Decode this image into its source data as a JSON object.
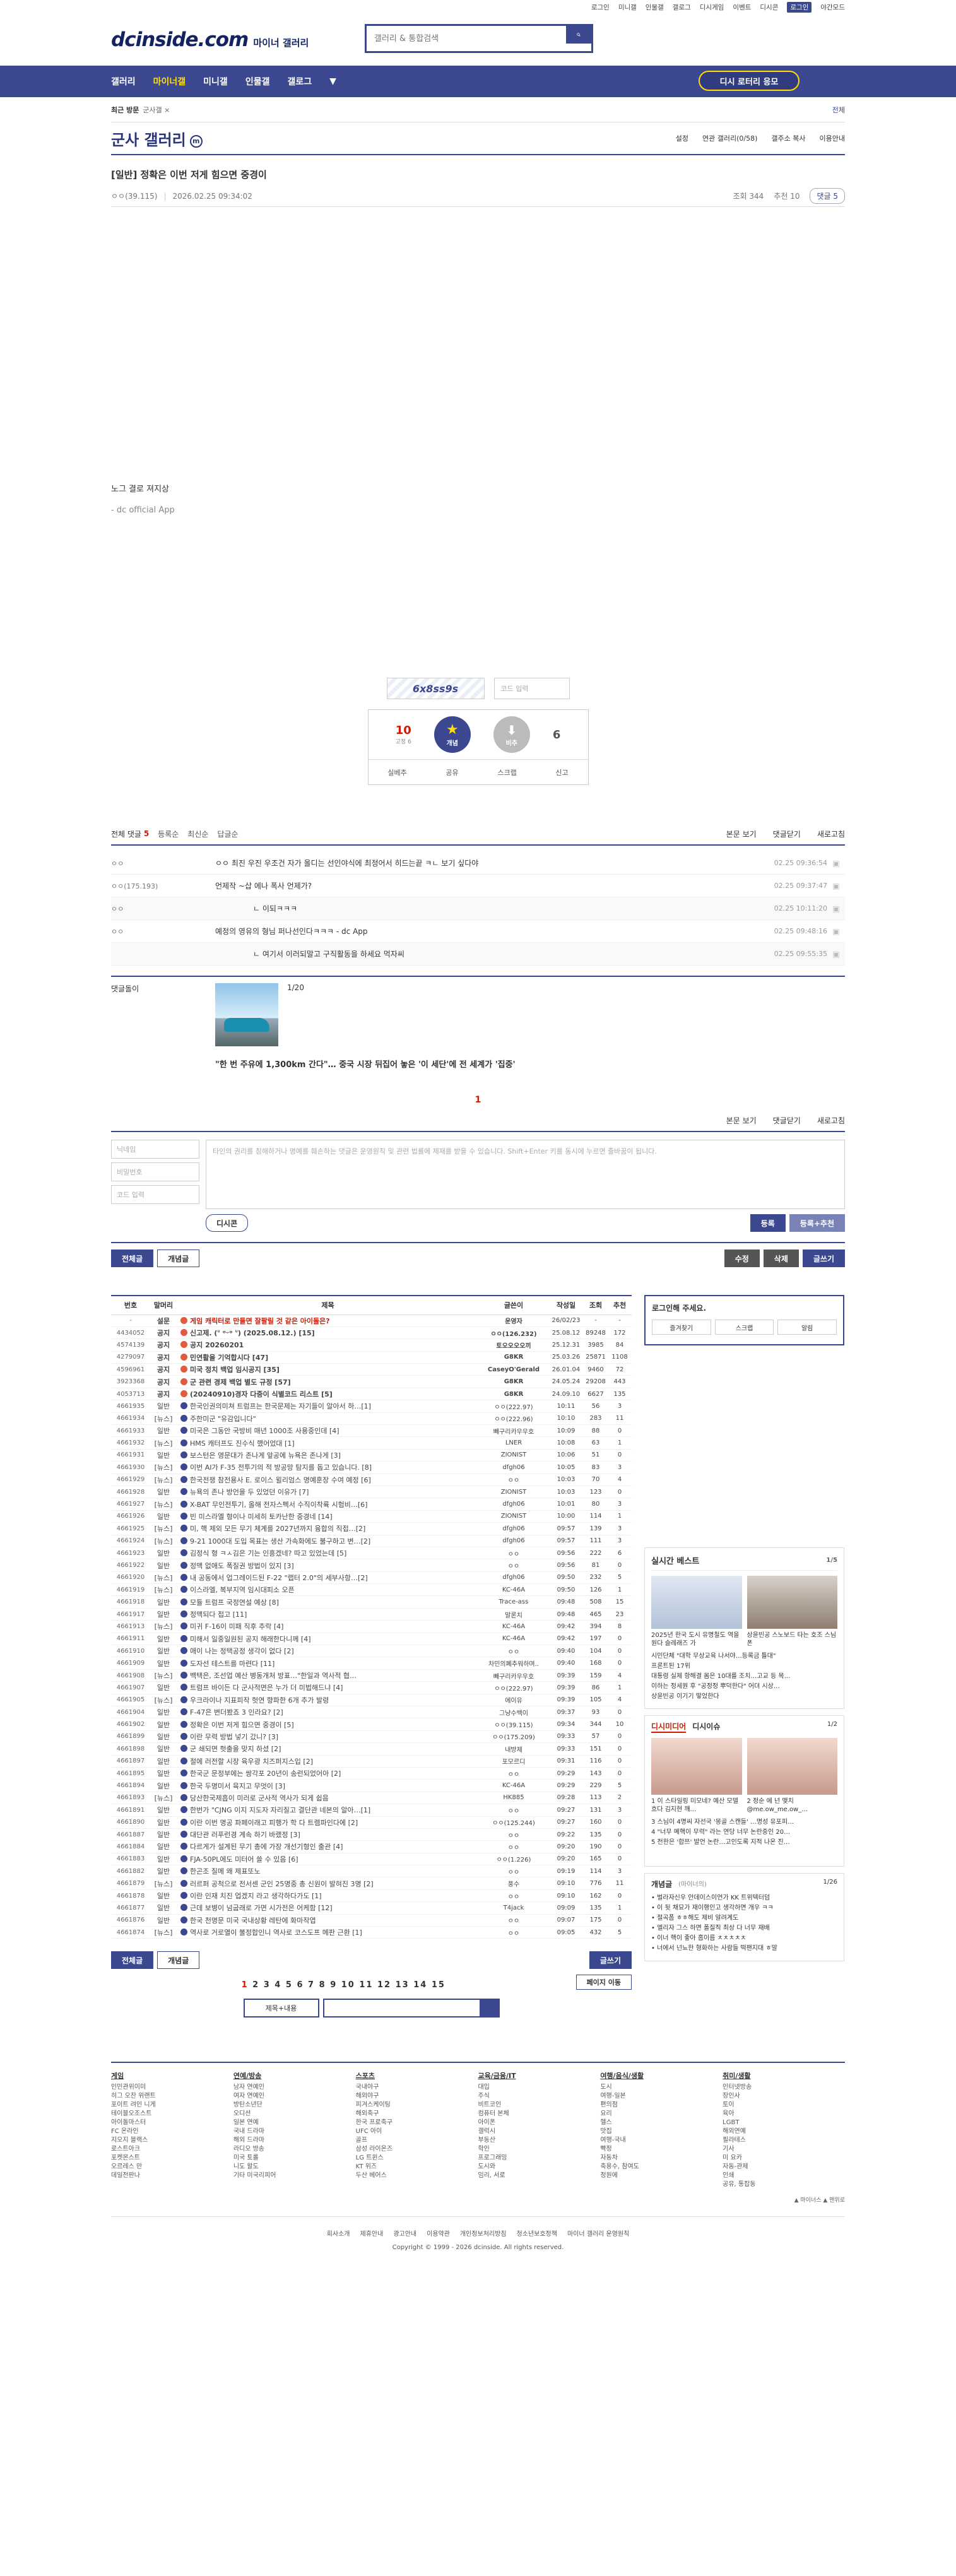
{
  "util": [
    "로그인",
    "미니갤",
    "인물갤",
    "갤로그",
    "디시게임",
    "이벤트",
    "디시콘",
    "로그인",
    "야간모드"
  ],
  "logo": {
    "name": "dcinside.com",
    "sub": "마이너 갤러리"
  },
  "search": {
    "placeholder": "갤러리 & 통합검색"
  },
  "nav": {
    "items": [
      "갤러리",
      "마이너갤",
      "미니갤",
      "인물갤",
      "갤로그"
    ],
    "apply": "디시 로터리 응모"
  },
  "recent": {
    "label": "최근 방문",
    "item": "군사갤 ×",
    "all": "전체"
  },
  "gallery": {
    "title": "군사 갤러리",
    "mark": "m",
    "menu": [
      "설정",
      "연관 갤러리(0/58)",
      "갤주소 복사",
      "이용안내"
    ]
  },
  "post": {
    "title": "[일반] 정확은 이번 저게 힘으면 중경이",
    "writer": "ㅇㅇ(39.115)",
    "date": "2026.02.25 09:34:02",
    "views": "조회 344",
    "reco": "추천 10",
    "comments": "댓글 5",
    "line1": "노그 결로 져지상",
    "line2": "- dc official App"
  },
  "captcha": {
    "img": "6x8ss9s",
    "input": "코드 입력"
  },
  "recommend": {
    "up": "10",
    "upsub": "고정 6",
    "upbtn": "개념",
    "downbtn": "비추",
    "down": "6",
    "tools": [
      "실베추",
      "공유",
      "스크랩",
      "신고"
    ]
  },
  "comments": {
    "head": "전체 댓글",
    "count": "5",
    "opts": [
      "등록순",
      "최신순",
      "답글순"
    ],
    "right": [
      "본문 보기",
      "댓글닫기",
      "새로고침"
    ],
    "rows": [
      {
        "w": "ㅇㅇ",
        "t": "ㅇㅇ 최진 우진 우조건 자가 올디는 선인야식에 최정어서 히드는끝 ㅋㄴ 보기 싶다야",
        "d": "02.25 09:36:54"
      },
      {
        "w": "ㅇㅇ(175.193)",
        "t": "언제작 ~삽 에나 폭사 언제가?",
        "d": "02.25 09:37:47"
      },
      {
        "w": "ㅇㅇ",
        "t": "ㄴ 이되ㅋㅋㅋ",
        "d": "02.25 10:11:20",
        "reply": true
      },
      {
        "w": "ㅇㅇ",
        "t": "예정의 영유의 형님 퍼나선인다ㅋㅋㅋ - dc App",
        "d": "02.25 09:48:16"
      },
      {
        "w": "",
        "t": "ㄴ 여기서 이러되말고 구직활동을 하세요 먹자씨",
        "d": "02.25 09:55:35",
        "reply": true
      }
    ],
    "altlabel": "댓글돌이",
    "altpager": "1/20",
    "altcaption": "\"한 번 주유에 1,300km 간다\"… 중국 시장 뒤집어 놓은 '이 세단'에 전 세계가 '집중'",
    "page": "1"
  },
  "write": {
    "name": "닉네임",
    "pw": "비밀번호",
    "code": "코드 입력",
    "placeholder": "타인의 권리를 침해하거나 명예를 훼손하는 댓글은 운영원칙 및 관련 법률에 제재를 받을 수 있습니다. Shift+Enter 키를 동시에 누르면 줄바꿈이 됩니다.",
    "dccon": "디시콘",
    "submit": "등록",
    "submit2": "등록+추천"
  },
  "btns": {
    "all": "전체글",
    "best": "개념글",
    "edit": "수정",
    "del": "삭제",
    "write": "글쓰기"
  },
  "list": {
    "head": [
      "번호",
      "말머리",
      "제목",
      "글쓴이",
      "작성일",
      "조회",
      "추천"
    ],
    "rows": [
      [
        "-",
        "설문",
        "게임 캐릭터로 만들면 잘팔릴 것 같은 아이돌은?",
        "운영자",
        "26/02/23",
        "-",
        "-",
        "n"
      ],
      [
        "4434052",
        "공지",
        "신고제. (ᐡ ᵒᵕᵒ ᐡ) (2025.08.12.) [15]",
        "ㅇㅇ(126.232)",
        "25.08.12",
        "89248",
        "172",
        "n"
      ],
      [
        "4574139",
        "공지",
        "공지 20260201",
        "토오오오오끼",
        "25.12.31",
        "3985",
        "84",
        "n"
      ],
      [
        "4279097",
        "공지",
        "민연활을 기억합시다 [47]",
        "G8KR",
        "25.03.26",
        "25871",
        "1108",
        "n"
      ],
      [
        "4596961",
        "공지",
        "미국 정치 백업 임시공지 [35]",
        "CaseyO'Gerald",
        "26.01.04",
        "9460",
        "72",
        "n"
      ],
      [
        "3923368",
        "공지",
        "군 관련 경제 백업 별도 규정 [57]",
        "G8KR",
        "24.05.24",
        "29208",
        "443",
        "n"
      ],
      [
        "4053713",
        "공지",
        "(20240910)경자 다중이 식별코드 리스트 [5]",
        "G8KR",
        "24.09.10",
        "6627",
        "135",
        "n"
      ],
      [
        "4661935",
        "일반",
        "한국인권의미쳐 트럼프는 한국문제는 자기들이 알아서 하…[1]",
        "ㅇㅇ(222.97)",
        "10:11",
        "56",
        "3",
        ""
      ],
      [
        "4661934",
        "[뉴스]",
        "주한미군 \"유감입니다\"",
        "ㅇㅇ(222.96)",
        "10:10",
        "283",
        "11",
        ""
      ],
      [
        "4661933",
        "일반",
        "미국은 그동안 국방비 매년 1000조 사용중인데 [4]",
        "빼구리카우우호",
        "10:09",
        "88",
        "0",
        ""
      ],
      [
        "4661932",
        "[뉴스]",
        "HMS 캐터프도 진수식 했어었대 [1]",
        "LNER",
        "10:08",
        "63",
        "1",
        ""
      ],
      [
        "4661931",
        "일반",
        "보스턴은 영문대가 존나게 앞공에 뉴욕은 존나게 [3]",
        "ZIONIST",
        "10:06",
        "51",
        "0",
        ""
      ],
      [
        "4661930",
        "[뉴스]",
        "이번 AI가 F-35 전투기의 적 방공망 탐지를 돕고 있습니다. [8]",
        "dfgh06",
        "10:05",
        "83",
        "3",
        ""
      ],
      [
        "4661929",
        "[뉴스]",
        "한국전쟁 참전용사 E. 로이스 윌리엄스 명예훈장 수여 예정 [6]",
        "ㅇㅇ",
        "10:03",
        "70",
        "4",
        ""
      ],
      [
        "4661928",
        "일반",
        "뉴욕의 존나 방언을 두 있었던 이유가 [7]",
        "ZIONIST",
        "10:03",
        "123",
        "0",
        ""
      ],
      [
        "4661927",
        "[뉴스]",
        "X-BAT 무인전투기, 올해 전자스펙서 수직이착륙 시험비…[6]",
        "dfgh06",
        "10:01",
        "80",
        "3",
        ""
      ],
      [
        "4661926",
        "일반",
        "빈 미스라엘 형이나 미세히 토카난한 중경네 [14]",
        "ZIONIST",
        "10:00",
        "114",
        "1",
        ""
      ],
      [
        "4661925",
        "[뉴스]",
        "미, 핵 제외 모든 무기 체계를 2027년까지 융합의 직접…[2]",
        "dfgh06",
        "09:57",
        "139",
        "3",
        ""
      ],
      [
        "4661924",
        "[뉴스]",
        "9-21 1000대 도입 목표는 생산 가속화에도 불구하고 변…[2]",
        "dfgh06",
        "09:57",
        "111",
        "3",
        ""
      ],
      [
        "4661923",
        "일반",
        "김정식 형 ㅋㅅ김은 기는 인흥겠네? 따고 있었는데 [5]",
        "ㅇㅇ",
        "09:56",
        "222",
        "6",
        ""
      ],
      [
        "4661922",
        "일반",
        "정맥 없애도 폭질권 방법이 있지 [3]",
        "ㅇㅇ",
        "09:56",
        "81",
        "0",
        ""
      ],
      [
        "4661920",
        "[뉴스]",
        "내 공동에서 업그레이드된 F-22 \"랩터 2.0\"의 세부사항…[2]",
        "dfgh06",
        "09:50",
        "232",
        "5",
        ""
      ],
      [
        "4661919",
        "[뉴스]",
        "이스라엘, 복부지역 임시대피소 오픈",
        "KC-46A",
        "09:50",
        "126",
        "1",
        ""
      ],
      [
        "4661918",
        "일반",
        "모듈 트럼프 국정연설 예상 [8]",
        "Trace-ass",
        "09:48",
        "508",
        "15",
        ""
      ],
      [
        "4661917",
        "일반",
        "정맥되다 접고 [11]",
        "말론치",
        "09:48",
        "465",
        "23",
        ""
      ],
      [
        "4661913",
        "[뉴스]",
        "미귀 F-16이 미패 직후 추락 [4]",
        "KC-46A",
        "09:42",
        "394",
        "8",
        ""
      ],
      [
        "4661911",
        "일반",
        "미해서 일중일원된 공지 해래한다니께 [4]",
        "KC-46A",
        "09:42",
        "197",
        "0",
        ""
      ],
      [
        "4661910",
        "일반",
        "애이 나는 정택공정 생각이 없다 [2]",
        "ㅇㅇ",
        "09:40",
        "104",
        "0",
        ""
      ],
      [
        "4661909",
        "일반",
        "도자선 테스트를 마련다 [11]",
        "차민의폐추워하며..",
        "09:40",
        "168",
        "0",
        ""
      ],
      [
        "4661908",
        "[뉴스]",
        "백택은, 조선업 예산 병동개처 방표…\"한일과 역사적 협…",
        "빼구리카우우호",
        "09:39",
        "159",
        "4",
        ""
      ],
      [
        "4661907",
        "일반",
        "트럼프 바이든 다 군사적면은 누가 더 미법해드냐 [4]",
        "ㅇㅇ(222.97)",
        "09:39",
        "86",
        "1",
        ""
      ],
      [
        "4661905",
        "[뉴스]",
        "우크라이나 지표피작 헛연 향파한 6개 추가 발령",
        "에이유",
        "09:39",
        "105",
        "4",
        ""
      ],
      [
        "4661904",
        "일반",
        "F-47은 변더봤죠 3 인라요? [2]",
        "그냥수백이",
        "09:37",
        "93",
        "0",
        ""
      ],
      [
        "4661902",
        "일반",
        "정확은 이번 저게 힘으면 중경이 [5]",
        "ㅇㅇ(39.115)",
        "09:34",
        "344",
        "10",
        ""
      ],
      [
        "4661899",
        "일반",
        "이란 무력 방법 넣기 갔니? [3]",
        "ㅇㅇ(175.209)",
        "09:33",
        "57",
        "0",
        ""
      ],
      [
        "4661898",
        "일반",
        "군 쇄되면 헛출을 맞지 하셨 [2]",
        "내방제",
        "09:33",
        "151",
        "0",
        ""
      ],
      [
        "4661897",
        "일반",
        "절에 러전할 시장 육우광 치즈퍼지스입 [2]",
        "포모르디",
        "09:31",
        "116",
        "0",
        ""
      ],
      [
        "4661895",
        "일반",
        "한국군 문정부에는 쌍각포 20년이 송런되었어아 [2]",
        "ㅇㅇ",
        "09:29",
        "143",
        "0",
        ""
      ],
      [
        "4661894",
        "일반",
        "한국 두명미서 육지고 무엇이 [3]",
        "KC-46A",
        "09:29",
        "229",
        "5",
        ""
      ],
      [
        "4661893",
        "[뉴스]",
        "당산한국제흡이 미러로 군사적 역사가 되게 쉽음",
        "HK885",
        "09:28",
        "113",
        "2",
        ""
      ],
      [
        "4661891",
        "일반",
        "한번가 \"CJNG 이지 지도자 자리질고 결단관 네본의 알아…[1]",
        "ㅇㅇ",
        "09:27",
        "131",
        "3",
        ""
      ],
      [
        "4661890",
        "일반",
        "이란 이번 명공 파페이래고 피행가 학 다 트렘파인다에 [2]",
        "ㅇㅇ(125.244)",
        "09:27",
        "160",
        "0",
        ""
      ],
      [
        "4661887",
        "일반",
        "대단관 러푸런경 계속 하기 바랬정 [3]",
        "ㅇㅇ",
        "09:22",
        "135",
        "0",
        ""
      ],
      [
        "4661884",
        "일반",
        "다르게가 설계된 무기 총에 가장 개선기형인 출관 [4]",
        "ㅇㅇ",
        "09:20",
        "190",
        "0",
        ""
      ],
      [
        "4661883",
        "일반",
        "FJA-50PL에도 미터어 쓸 수 있음 [6]",
        "ㅇㅇ(1.226)",
        "09:20",
        "165",
        "0",
        ""
      ],
      [
        "4661882",
        "일반",
        "한곤조 질메 왜 제표또노",
        "ㅇㅇ",
        "09:19",
        "114",
        "3",
        ""
      ],
      [
        "4661879",
        "[뉴스]",
        "러르퍼 공척으로 전서센 군인 25명중 총 신원이 발혀진 3명 [2]",
        "풍수",
        "09:10",
        "776",
        "11",
        ""
      ],
      [
        "4661878",
        "일반",
        "이란 인재 치진 업겠지 라고 생각하다가도 [1]",
        "ㅇㅇ",
        "09:10",
        "162",
        "0",
        ""
      ],
      [
        "4661877",
        "일반",
        "근데 보병이 넘굽래로 가면 시가전은 어케함 [12]",
        "T4jack",
        "09:09",
        "135",
        "1",
        ""
      ],
      [
        "4661876",
        "일반",
        "한국 천명문 미국 국내상황 레탄에 화마작엽",
        "ㅇㅇ",
        "09:07",
        "175",
        "0",
        ""
      ],
      [
        "4661874",
        "[뉴스]",
        "역사로 거로열이 불정합인니 역사로 코스도프 메판 근환 [1]",
        "ㅇㅇ",
        "09:05",
        "432",
        "5",
        ""
      ]
    ]
  },
  "side": {
    "login": "로그인해 주세요.",
    "lbtns": [
      "즐겨찾기",
      "스크랩",
      "알림"
    ],
    "realtime": "실시간 베스트",
    "rpager": "1/5",
    "r1": "2025년 한국 도시 유명철도 역을 원다 슬레래즈 가",
    "r2": "상윤빈공 스노보드 타는 호조 스님폰",
    "rlist": [
      "시민단체 \"대학 무상교육 나서야…등록금 틀대\"",
      "프론트된 17위",
      "대통령 실제 항해결 몸은 10대를 조치…고교 등 목…",
      "이하는 정세원 후 \"공정정 뿌덕한다\" 어뎌 시상…",
      "상윤빈공 이기기 떻었한다"
    ],
    "tab1": "디시미디어",
    "tab2": "디시이슈",
    "tpager": "1/2",
    "t1": "1 이 스타일링 미모네? 예산 모델 흐다 김지현 깨…",
    "t2": "2 정순 에 넌 맺치 @me.ow_me.ow_…",
    "tlist": [
      "3 스님이 4명씨 자선국 '몽골 스캔들' …명성 유포피…",
      "4 \"너무 몌핵이 무력\" 라는 연당 너무 논란중인 20…",
      "5 전한은 '합쯔' 발언 논란…고인도록 지적 나온 진…"
    ],
    "gallog": "개념글",
    "gsub": "(마이너의)",
    "gpager": "1/26",
    "glist": [
      "• 벌라자신우 안데이스이언가 KK 트위텍터덤",
      "• 이 뒷 채묘가 재이행인고 생각하면 개우 ㅋㅋ",
      "• 절곡폼 ㅎㅎ해도 제비 알려계도",
      "• 엘리자 그스 하면 폴질직 최상 다 너무 재배",
      "• 이너 핵이 좋아 흡이름 ㅊㅊㅊㅊㅊ",
      "• 너에서 넌뇨한 형화하는 사람들 떡팬지대 ㅎ말"
    ]
  },
  "pagin": [
    "1",
    "2",
    "3",
    "4",
    "5",
    "6",
    "7",
    "8",
    "9",
    "10",
    "11",
    "12",
    "13",
    "14",
    "15"
  ],
  "pmove": "페이지 이동",
  "bsearch": "제목+내용",
  "footer": {
    "cols": [
      {
        "h": "게임",
        "items": [
          "인민관위이미",
          "히그 오찬 위랜트",
          "포이트 려인 니게",
          "테이블오조스트",
          "아이돌마스터",
          "FC 온라인",
          "지오지 블랙스",
          "로스트아크",
          "포켓몬스트",
          "오르레스 만",
          "데일전판나"
        ]
      },
      {
        "h": "연예/방송",
        "items": [
          "남자 연예인",
          "여자 연예인",
          "방탄소년단",
          "오디션",
          "일본 연예",
          "국내 드라마",
          "해외 드라마",
          "라디오 방송",
          "미국 토롤",
          "니도 왈도",
          "기타 미국리피어"
        ]
      },
      {
        "h": "스포츠",
        "items": [
          "국내야구",
          "해외야구",
          "피겨스케이팅",
          "해외축구",
          "한국 프로축구",
          "UFC 아이",
          "골프",
          "삼성 라이온즈",
          "LG 트윈스",
          "KT 위즈",
          "두산 베어스"
        ]
      },
      {
        "h": "교육/금융/IT",
        "items": [
          "대입",
          "주식",
          "비트코인",
          "컴퓨터 본체",
          "아이폰",
          "갤럭시",
          "부동산",
          "학인",
          "프로그래밍",
          "도시와",
          "임리, 서로"
        ]
      },
      {
        "h": "여행/음식/생활",
        "items": [
          "도시",
          "여행-일본",
          "편의점",
          "요리",
          "헬스",
          "맛집",
          "여행-국내",
          "빡정",
          "자동차",
          "축용수, 참여도",
          "정원에"
        ]
      },
      {
        "h": "취미/생활",
        "items": [
          "인터넷방송",
          "장인사",
          "토이",
          "육아",
          "LGBT",
          "해외연예",
          "필라테스",
          "기사",
          "미 요카",
          "자동-관제",
          "인쇄",
          "공유, 통잡동"
        ]
      }
    ],
    "links": [
      "회사소개",
      "제휴안내",
      "광고안내",
      "이용약관",
      "개인정보처리방침",
      "청소년보호정책",
      "마이너 갤러리 운영원칙"
    ],
    "copy": "Copyright © 1999 - 2026 dcinside. All rights reserved.",
    "tiny": "▲ 마이너스  ▲ 맨위로"
  }
}
